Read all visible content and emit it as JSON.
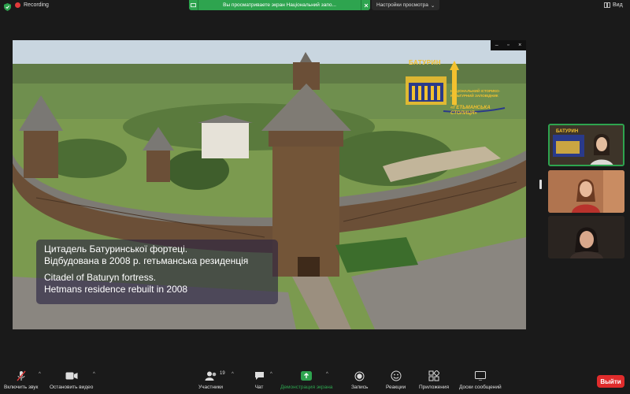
{
  "top": {
    "recording_label": "Recording",
    "share_banner_text": "Вы просматриваете экран Національний запо...",
    "view_settings_label": "Настройки просмотра",
    "view_label": "Вид"
  },
  "shared_screen": {
    "logo_title": "БАТУРИН",
    "logo_subtitle": "НАЦІОНАЛЬНИЙ ІСТОРИКО-КУЛЬТУРНИЙ ЗАПОВІДНИК",
    "logo_motto": "«ГЕТЬМАНСЬКА СТОЛИЦЯ»",
    "caption": {
      "uk_line1": "Цитадель Батуринської фортеці.",
      "uk_line2": "Відбудована  в 2008 р. гетьманська резиденція",
      "en_line1": "Citadel of Baturyn fortress.",
      "en_line2": "Hetmans residence rebuilt in 2008"
    }
  },
  "gallery": {
    "tile1_logo": "БАТУРИН"
  },
  "toolbar": {
    "mute_label": "Включить звук",
    "video_label": "Остановить видео",
    "participants_label": "Участники",
    "participants_count": "19",
    "chat_label": "Чат",
    "share_label": "Демонстрация экрана",
    "record_label": "Запись",
    "reactions_label": "Реакции",
    "apps_label": "Приложения",
    "whiteboard_label": "Доски сообщений",
    "leave_label": "Выйти"
  },
  "colors": {
    "accent_green": "#2ea44f",
    "leave_red": "#e02c2c",
    "logo_gold": "#f3c12f",
    "caption_bg": "#282240"
  }
}
